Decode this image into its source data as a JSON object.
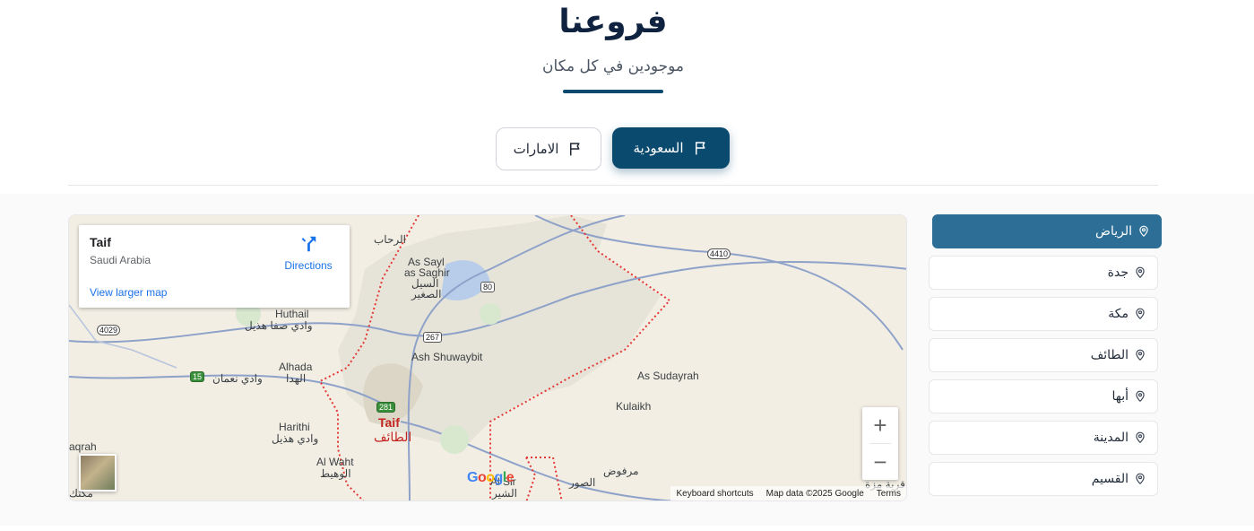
{
  "header": {
    "title": "فروعنا",
    "subtitle": "موجودين في كل مكان"
  },
  "tabs": [
    {
      "label": "السعودية",
      "icon": "flag-icon",
      "active": true
    },
    {
      "label": "الامارات",
      "icon": "flag-icon",
      "active": false
    }
  ],
  "branches": [
    {
      "label": "الرياض",
      "icon": "map-pin-icon",
      "active": true
    },
    {
      "label": "جدة",
      "icon": "map-pin-icon",
      "active": false
    },
    {
      "label": "مكة",
      "icon": "map-pin-icon",
      "active": false
    },
    {
      "label": "الطائف",
      "icon": "map-pin-icon",
      "active": false
    },
    {
      "label": "أبها",
      "icon": "map-pin-icon",
      "active": false
    },
    {
      "label": "المدينة",
      "icon": "map-pin-icon",
      "active": false
    },
    {
      "label": "القسيم",
      "icon": "map-pin-icon",
      "active": false
    }
  ],
  "map": {
    "card": {
      "place": "Taif",
      "country": "Saudi Arabia",
      "directions": "Directions",
      "view_larger": "View larger map"
    },
    "zoom_in": "+",
    "zoom_out": "−",
    "footer": {
      "shortcuts": "Keyboard shortcuts",
      "data": "Map data ©2025 Google",
      "terms": "Terms"
    },
    "logo": "Google",
    "labels": {
      "taif_en": "Taif",
      "taif_ar": "الطائف",
      "as_sayl": "As Sayl",
      "as_saghir": "as Saghir",
      "as_sayl_ar": "السيل",
      "as_saghir_ar": "الصغير",
      "ash_shuwaybit": "Ash Shuwaybit",
      "as_sudayrah": "As Sudayrah",
      "kulaikh": "Kulaikh",
      "huthail": "Huthail",
      "huthail_ar": "وادي صفا هذيل",
      "alhada": "Alhada",
      "alhada_ar": "الهدا",
      "wadi_naman": "وادي نعمان",
      "harithi": "Harithi",
      "harithi_ar": "وادي هذيل",
      "al_waht": "Al Waht",
      "al_waht_ar": "الوهيط",
      "ar_rihab": "الرحاب",
      "marfud": "مرفوض",
      "as_sur": "الصور",
      "al_sir": "Al Sir",
      "al_sir_ar": "الشير",
      "qaryat": "قرية مزة",
      "aqrah": "aqrah",
      "makkah_ar": "مكتك"
    },
    "routes": {
      "r4410": "4410",
      "r80": "80",
      "r267": "267",
      "r4029": "4029",
      "r15": "15",
      "r281": "281"
    }
  }
}
